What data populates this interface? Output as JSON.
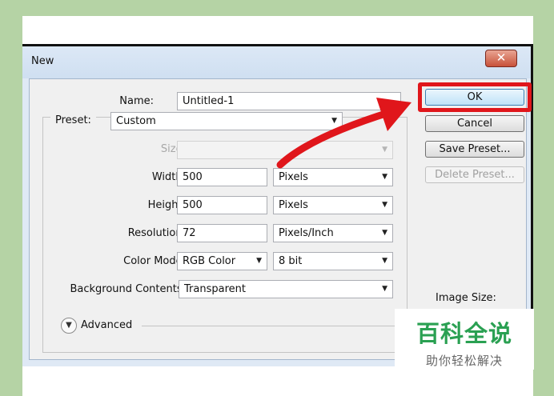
{
  "dialog": {
    "title": "New",
    "close_glyph": "✕"
  },
  "form": {
    "name": {
      "label": "Name:",
      "value": "Untitled-1"
    },
    "preset": {
      "label": "Preset:",
      "value": "Custom"
    },
    "size": {
      "label": "Size:",
      "value": ""
    },
    "width": {
      "label": "Width:",
      "value": "500",
      "unit": "Pixels"
    },
    "height": {
      "label": "Height:",
      "value": "500",
      "unit": "Pixels"
    },
    "resolution": {
      "label": "Resolution:",
      "value": "72",
      "unit": "Pixels/Inch"
    },
    "color_mode": {
      "label": "Color Mode:",
      "value": "RGB Color",
      "depth": "8 bit"
    },
    "background": {
      "label": "Background Contents:",
      "value": "Transparent"
    },
    "advanced": {
      "label": "Advanced"
    }
  },
  "buttons": {
    "ok": "OK",
    "cancel": "Cancel",
    "save_preset": "Save Preset...",
    "delete_preset": "Delete Preset..."
  },
  "image_size_label": "Image Size:",
  "annotation": {
    "highlight_color": "#e0161b"
  },
  "watermark": {
    "title": "百科全说",
    "subtitle": "助你轻松解决"
  }
}
